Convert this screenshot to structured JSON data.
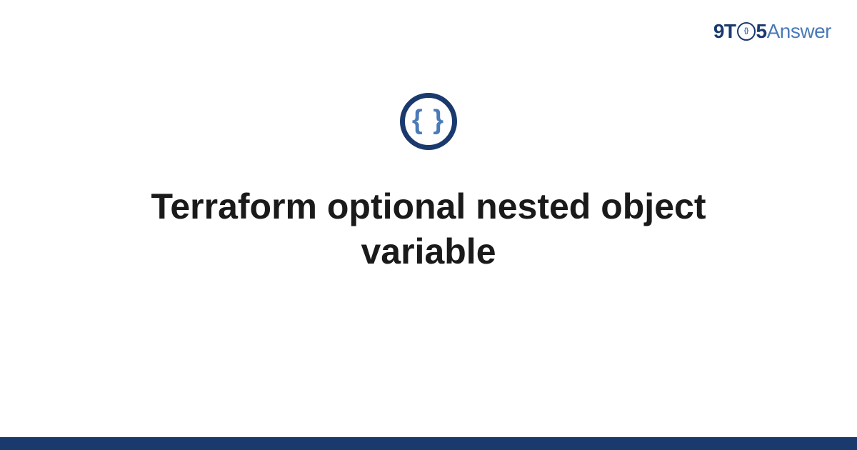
{
  "brand": {
    "part1": "9T",
    "o_inner": "{}",
    "part2": "5",
    "part3": "Answer"
  },
  "icon": {
    "glyph": "{ }",
    "name": "code-braces-icon"
  },
  "title": "Terraform optional nested object variable",
  "colors": {
    "dark_blue": "#1a3a6e",
    "light_blue": "#4a7ab8",
    "text": "#1a1a1a",
    "background": "#ffffff"
  }
}
